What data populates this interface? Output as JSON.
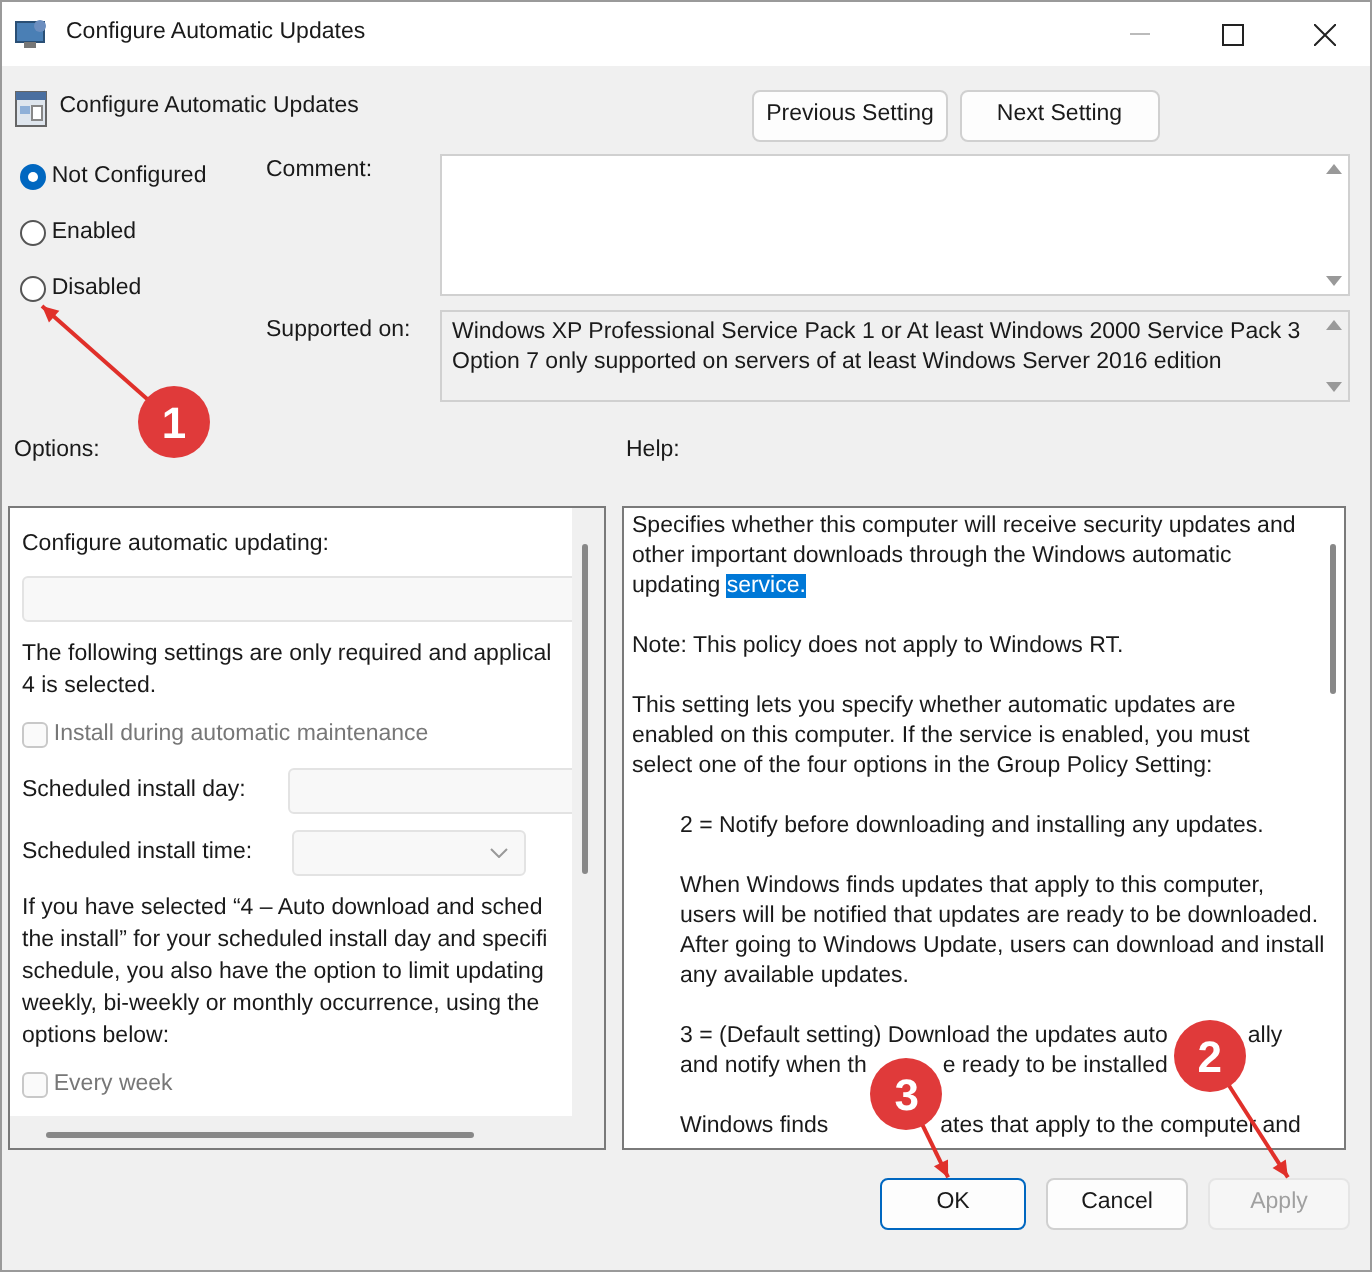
{
  "window": {
    "title": "Configure Automatic Updates"
  },
  "header": {
    "title": "Configure Automatic Updates"
  },
  "nav_buttons": [
    "Previous Setting",
    "Next Setting"
  ],
  "state_options": [
    {
      "label": "Not Configured",
      "selected": true
    },
    {
      "label": "Enabled",
      "selected": false
    },
    {
      "label": "Disabled",
      "selected": false
    }
  ],
  "comment": {
    "label": "Comment:"
  },
  "supported_on": {
    "label": "Supported on:",
    "lines": [
      "Windows XP Professional Service Pack 1 or At least Windows 2000 Service Pack 3",
      "Option 7 only supported on servers of at least Windows Server 2016 edition"
    ]
  },
  "options": {
    "label": "Options:",
    "items": [
      {
        "kind": "heading",
        "lines": [
          "Configure automatic updating:"
        ]
      },
      {
        "kind": "textbox"
      },
      {
        "kind": "paragraph",
        "lines": [
          "The following settings are only required and applical",
          "4 is selected."
        ]
      },
      {
        "kind": "checkbox",
        "label": "Install during automatic maintenance",
        "checked": false,
        "disabled": true
      },
      {
        "kind": "field",
        "label": "Scheduled install day:"
      },
      {
        "kind": "dropdown",
        "label": "Scheduled install time:"
      },
      {
        "kind": "paragraph",
        "lines": [
          "If you have selected “4 – Auto download and sched",
          "the install” for your scheduled install day and specifi",
          "schedule, you also have the option to limit updating",
          "weekly, bi-weekly or monthly occurrence, using the",
          "options below:"
        ]
      },
      {
        "kind": "checkbox",
        "label": "Every week",
        "checked": false,
        "disabled": true
      }
    ]
  },
  "help": {
    "label": "Help:",
    "paragraphs": [
      {
        "kind": "plain",
        "lines": [
          "Specifies whether this computer will receive security updates and",
          "other important downloads through the Windows automatic",
          "updating"
        ],
        "selected_text": "service."
      },
      {
        "kind": "plain",
        "lines": [
          "Note: This policy does not apply to Windows RT."
        ]
      },
      {
        "kind": "plain",
        "lines": [
          "This setting lets you specify whether automatic updates are",
          "enabled on this computer. If the service is enabled, you must",
          "select one of the four options in the Group Policy Setting:"
        ]
      },
      {
        "kind": "indented",
        "lines": [
          "2 = Notify before downloading and installing any updates."
        ]
      },
      {
        "kind": "indented",
        "lines": [
          "When Windows finds updates that apply to this computer,",
          "users will be notified that updates are ready to be downloaded.",
          "After going to Windows Update, users can download and install",
          "any available updates."
        ]
      },
      {
        "kind": "indented",
        "lines": [
          [
            "3 = (Default setting) Download the updates auto",
            "ally"
          ],
          [
            "and notify when th",
            "e ready to be installed"
          ]
        ]
      },
      {
        "kind": "indented",
        "lines": [
          [
            "Windows finds",
            "ates that apply to the computer and"
          ]
        ]
      }
    ]
  },
  "footer_buttons": [
    {
      "label": "OK",
      "default": true,
      "disabled": false
    },
    {
      "label": "Cancel",
      "default": false,
      "disabled": false
    },
    {
      "label": "Apply",
      "default": false,
      "disabled": true
    }
  ],
  "annotations": [
    {
      "number": "1"
    },
    {
      "number": "2"
    },
    {
      "number": "3"
    }
  ]
}
